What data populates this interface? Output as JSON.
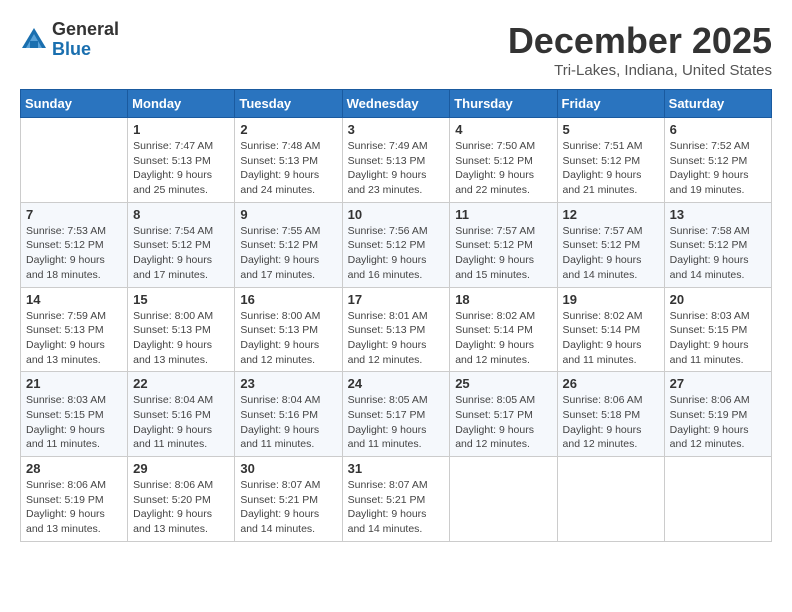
{
  "logo": {
    "general": "General",
    "blue": "Blue"
  },
  "title": "December 2025",
  "location": "Tri-Lakes, Indiana, United States",
  "weekdays": [
    "Sunday",
    "Monday",
    "Tuesday",
    "Wednesday",
    "Thursday",
    "Friday",
    "Saturday"
  ],
  "weeks": [
    [
      {
        "day": "",
        "info": ""
      },
      {
        "day": "1",
        "info": "Sunrise: 7:47 AM\nSunset: 5:13 PM\nDaylight: 9 hours\nand 25 minutes."
      },
      {
        "day": "2",
        "info": "Sunrise: 7:48 AM\nSunset: 5:13 PM\nDaylight: 9 hours\nand 24 minutes."
      },
      {
        "day": "3",
        "info": "Sunrise: 7:49 AM\nSunset: 5:13 PM\nDaylight: 9 hours\nand 23 minutes."
      },
      {
        "day": "4",
        "info": "Sunrise: 7:50 AM\nSunset: 5:12 PM\nDaylight: 9 hours\nand 22 minutes."
      },
      {
        "day": "5",
        "info": "Sunrise: 7:51 AM\nSunset: 5:12 PM\nDaylight: 9 hours\nand 21 minutes."
      },
      {
        "day": "6",
        "info": "Sunrise: 7:52 AM\nSunset: 5:12 PM\nDaylight: 9 hours\nand 19 minutes."
      }
    ],
    [
      {
        "day": "7",
        "info": "Sunrise: 7:53 AM\nSunset: 5:12 PM\nDaylight: 9 hours\nand 18 minutes."
      },
      {
        "day": "8",
        "info": "Sunrise: 7:54 AM\nSunset: 5:12 PM\nDaylight: 9 hours\nand 17 minutes."
      },
      {
        "day": "9",
        "info": "Sunrise: 7:55 AM\nSunset: 5:12 PM\nDaylight: 9 hours\nand 17 minutes."
      },
      {
        "day": "10",
        "info": "Sunrise: 7:56 AM\nSunset: 5:12 PM\nDaylight: 9 hours\nand 16 minutes."
      },
      {
        "day": "11",
        "info": "Sunrise: 7:57 AM\nSunset: 5:12 PM\nDaylight: 9 hours\nand 15 minutes."
      },
      {
        "day": "12",
        "info": "Sunrise: 7:57 AM\nSunset: 5:12 PM\nDaylight: 9 hours\nand 14 minutes."
      },
      {
        "day": "13",
        "info": "Sunrise: 7:58 AM\nSunset: 5:12 PM\nDaylight: 9 hours\nand 14 minutes."
      }
    ],
    [
      {
        "day": "14",
        "info": "Sunrise: 7:59 AM\nSunset: 5:13 PM\nDaylight: 9 hours\nand 13 minutes."
      },
      {
        "day": "15",
        "info": "Sunrise: 8:00 AM\nSunset: 5:13 PM\nDaylight: 9 hours\nand 13 minutes."
      },
      {
        "day": "16",
        "info": "Sunrise: 8:00 AM\nSunset: 5:13 PM\nDaylight: 9 hours\nand 12 minutes."
      },
      {
        "day": "17",
        "info": "Sunrise: 8:01 AM\nSunset: 5:13 PM\nDaylight: 9 hours\nand 12 minutes."
      },
      {
        "day": "18",
        "info": "Sunrise: 8:02 AM\nSunset: 5:14 PM\nDaylight: 9 hours\nand 12 minutes."
      },
      {
        "day": "19",
        "info": "Sunrise: 8:02 AM\nSunset: 5:14 PM\nDaylight: 9 hours\nand 11 minutes."
      },
      {
        "day": "20",
        "info": "Sunrise: 8:03 AM\nSunset: 5:15 PM\nDaylight: 9 hours\nand 11 minutes."
      }
    ],
    [
      {
        "day": "21",
        "info": "Sunrise: 8:03 AM\nSunset: 5:15 PM\nDaylight: 9 hours\nand 11 minutes."
      },
      {
        "day": "22",
        "info": "Sunrise: 8:04 AM\nSunset: 5:16 PM\nDaylight: 9 hours\nand 11 minutes."
      },
      {
        "day": "23",
        "info": "Sunrise: 8:04 AM\nSunset: 5:16 PM\nDaylight: 9 hours\nand 11 minutes."
      },
      {
        "day": "24",
        "info": "Sunrise: 8:05 AM\nSunset: 5:17 PM\nDaylight: 9 hours\nand 11 minutes."
      },
      {
        "day": "25",
        "info": "Sunrise: 8:05 AM\nSunset: 5:17 PM\nDaylight: 9 hours\nand 12 minutes."
      },
      {
        "day": "26",
        "info": "Sunrise: 8:06 AM\nSunset: 5:18 PM\nDaylight: 9 hours\nand 12 minutes."
      },
      {
        "day": "27",
        "info": "Sunrise: 8:06 AM\nSunset: 5:19 PM\nDaylight: 9 hours\nand 12 minutes."
      }
    ],
    [
      {
        "day": "28",
        "info": "Sunrise: 8:06 AM\nSunset: 5:19 PM\nDaylight: 9 hours\nand 13 minutes."
      },
      {
        "day": "29",
        "info": "Sunrise: 8:06 AM\nSunset: 5:20 PM\nDaylight: 9 hours\nand 13 minutes."
      },
      {
        "day": "30",
        "info": "Sunrise: 8:07 AM\nSunset: 5:21 PM\nDaylight: 9 hours\nand 14 minutes."
      },
      {
        "day": "31",
        "info": "Sunrise: 8:07 AM\nSunset: 5:21 PM\nDaylight: 9 hours\nand 14 minutes."
      },
      {
        "day": "",
        "info": ""
      },
      {
        "day": "",
        "info": ""
      },
      {
        "day": "",
        "info": ""
      }
    ]
  ]
}
